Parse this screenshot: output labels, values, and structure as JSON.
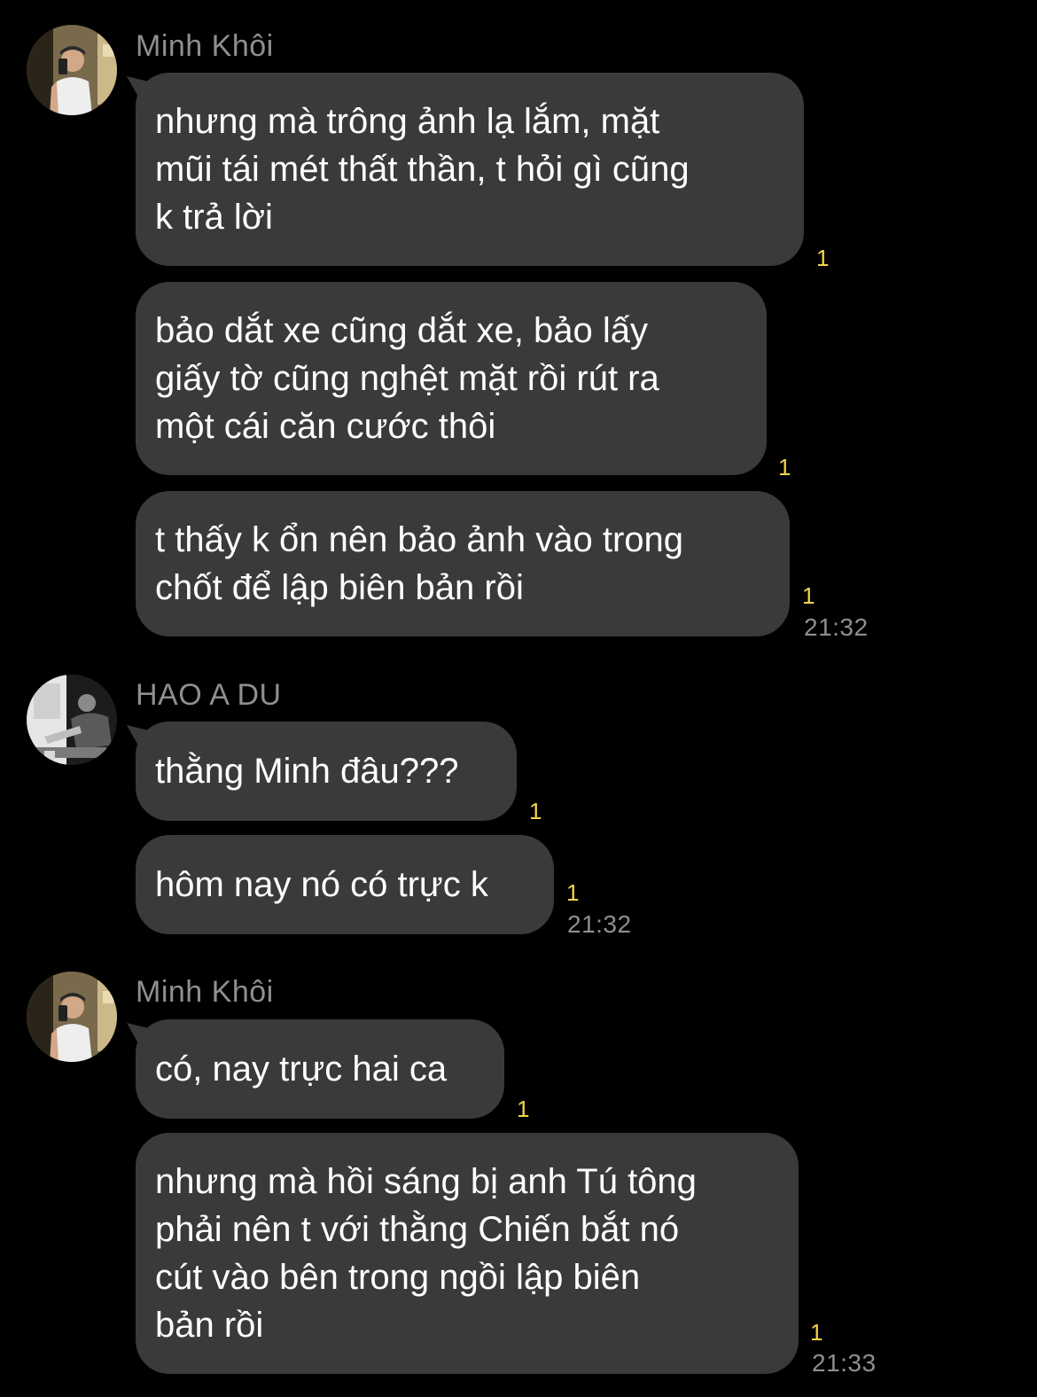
{
  "groups": [
    {
      "sender": "Minh Khôi",
      "messages": [
        {
          "text": "nhưng mà trông ảnh lạ lắm, mặt\nmũi tái mét thất thần, t hỏi gì cũng\nk trả lời",
          "read": "1"
        },
        {
          "text": "bảo dắt xe cũng dắt xe, bảo lấy\ngiấy tờ cũng nghệt mặt rồi rút ra\nmột cái căn cước thôi",
          "read": "1"
        },
        {
          "text": "t thấy k ổn nên bảo ảnh vào trong\nchốt để lập biên bản rồi",
          "read": "1",
          "time": "21:32"
        }
      ]
    },
    {
      "sender": "HAO A DU",
      "messages": [
        {
          "text": "thằng Minh đâu???",
          "read": "1"
        },
        {
          "text": "hôm nay nó có trực k",
          "read": "1",
          "time": "21:32"
        }
      ]
    },
    {
      "sender": "Minh Khôi",
      "messages": [
        {
          "text": "có, nay trực hai ca",
          "read": "1"
        },
        {
          "text": "nhưng mà hồi sáng bị anh Tú tông\nphải nên t với thằng Chiến bắt nó\ncút vào bên trong ngồi lập biên\nbản rồi",
          "read": "1",
          "time": "21:33"
        }
      ]
    }
  ]
}
